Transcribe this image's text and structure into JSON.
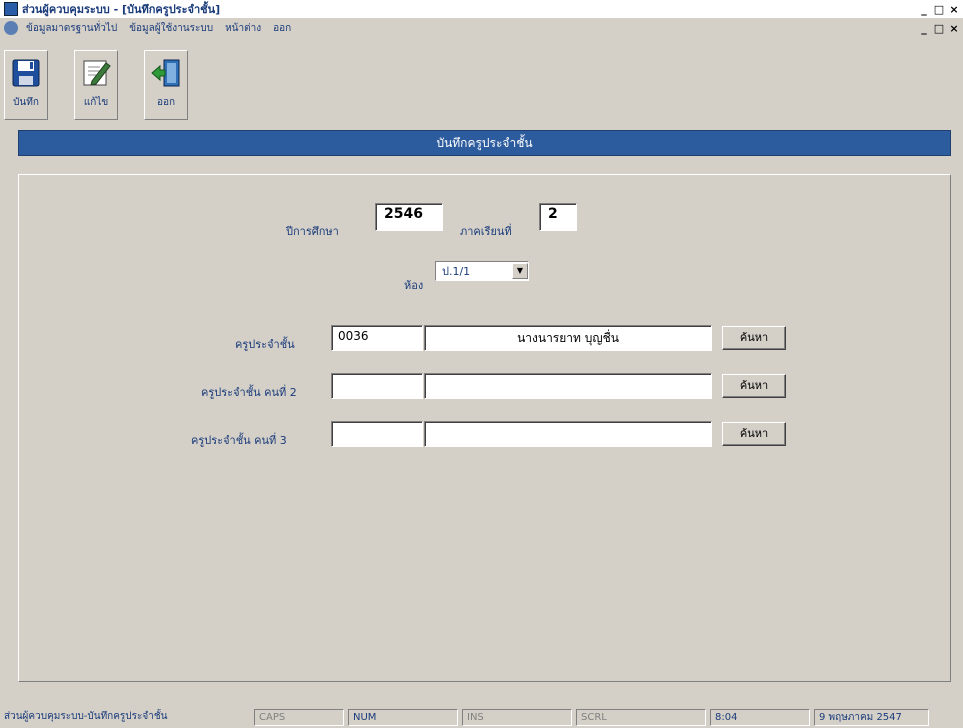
{
  "window": {
    "title": "ส่วนผู้ควบคุมระบบ - [บันทึกครูประจำชั้น]",
    "controls": [
      "_",
      "□",
      "×"
    ]
  },
  "menu": {
    "items": [
      "ข้อมูลมาตรฐานทั่วไป",
      "ข้อมูลผู้ใช้งานระบบ",
      "หน้าต่าง",
      "ออก"
    ],
    "doc_controls": [
      "_",
      "□",
      "×"
    ]
  },
  "toolbar": {
    "save_label": "บันทึก",
    "edit_label": "แก้ไข",
    "exit_label": "ออก"
  },
  "banner": {
    "title": "บันทึกครูประจำชั้น"
  },
  "form": {
    "year_label": "ปีการศึกษา",
    "year_value": "2546",
    "term_label": "ภาคเรียนที่",
    "term_value": "2",
    "room_label": "ห้อง",
    "room_value": "ป.1/1",
    "teachers": [
      {
        "label": "ครูประจำชั้น",
        "code": "0036",
        "name": "นางนารยาท บุญชื่น",
        "button": "ค้นหา"
      },
      {
        "label": "ครูประจำชั้น คนที่ 2",
        "code": "",
        "name": "",
        "button": "ค้นหา"
      },
      {
        "label": "ครูประจำชั้น คนที่ 3",
        "code": "",
        "name": "",
        "button": "ค้นหา"
      }
    ]
  },
  "status": {
    "caption": "ส่วนผู้ควบคุมระบบ-บันทึกครูประจำชั้น",
    "caps": "CAPS",
    "num": "NUM",
    "ins": "INS",
    "scrl": "SCRL",
    "time": "8:04",
    "date": "9 พฤษภาคม 2547"
  }
}
